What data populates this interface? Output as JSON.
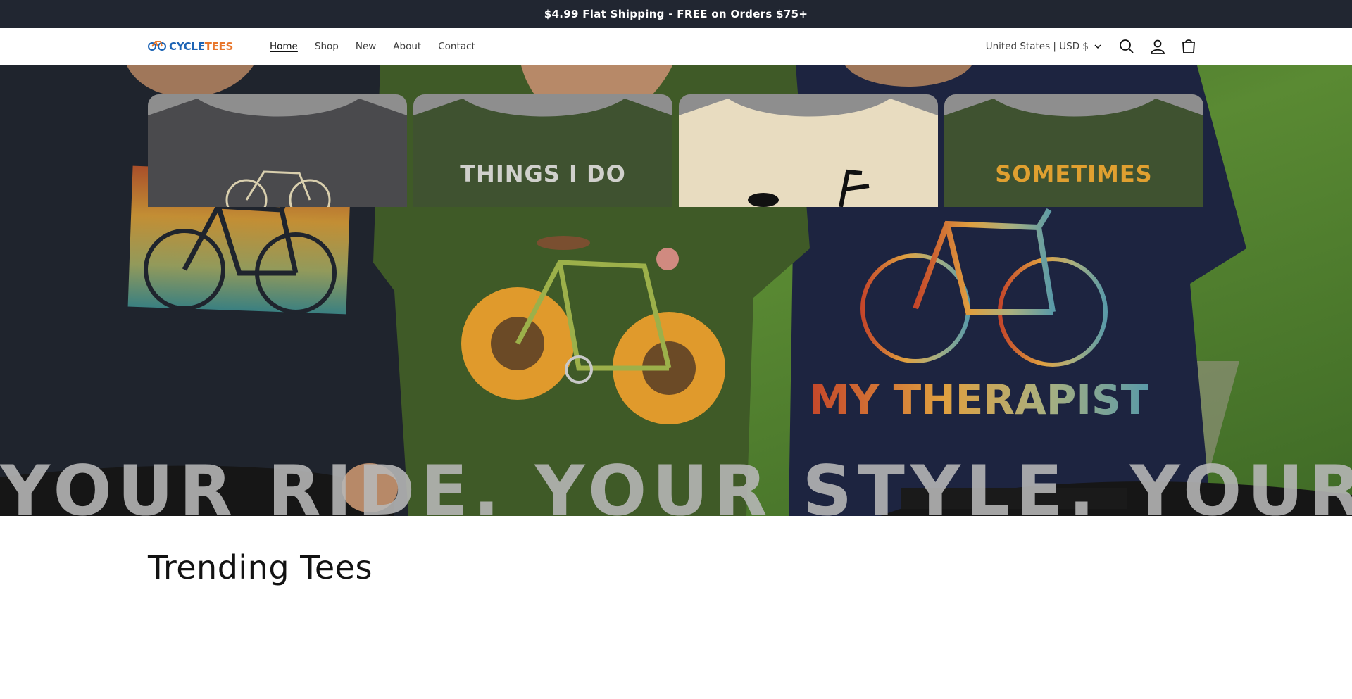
{
  "announcement": {
    "text": "$4.99 Flat Shipping - FREE on Orders $75+"
  },
  "header": {
    "logo": {
      "part1": "CYCLE",
      "part2": "TEES",
      "icon": "bicycle-logo-icon"
    },
    "nav": [
      {
        "label": "Home",
        "active": true
      },
      {
        "label": "Shop",
        "active": false
      },
      {
        "label": "New",
        "active": false
      },
      {
        "label": "About",
        "active": false
      },
      {
        "label": "Contact",
        "active": false
      }
    ],
    "country_selector": "United States | USD $",
    "icons": [
      "search-icon",
      "account-icon",
      "cart-icon"
    ]
  },
  "hero": {
    "title": "YOUR RIDE. YOUR STYLE. YOUR TEE.",
    "shirt_prints": {
      "right_tee_text": "MY THERAPIST"
    },
    "colors": {
      "left_tee": "#1f242d",
      "center_tee": "#3f5a27",
      "right_tee": "#1d2440",
      "foliage": "#4f7a2c"
    }
  },
  "trending": {
    "title": "Trending Tees",
    "cards": [
      {
        "tee_color": "#4a4a4d",
        "print_text": "",
        "print_color": "#d9cfae"
      },
      {
        "tee_color": "#3f5230",
        "print_text": "THINGS I DO",
        "print_color": "#d0d0cc"
      },
      {
        "tee_color": "#e8dcc0",
        "print_text": "",
        "print_color": "#111111"
      },
      {
        "tee_color": "#3f5230",
        "print_text": "SOMETIMES",
        "print_color": "#e0a030"
      }
    ]
  }
}
